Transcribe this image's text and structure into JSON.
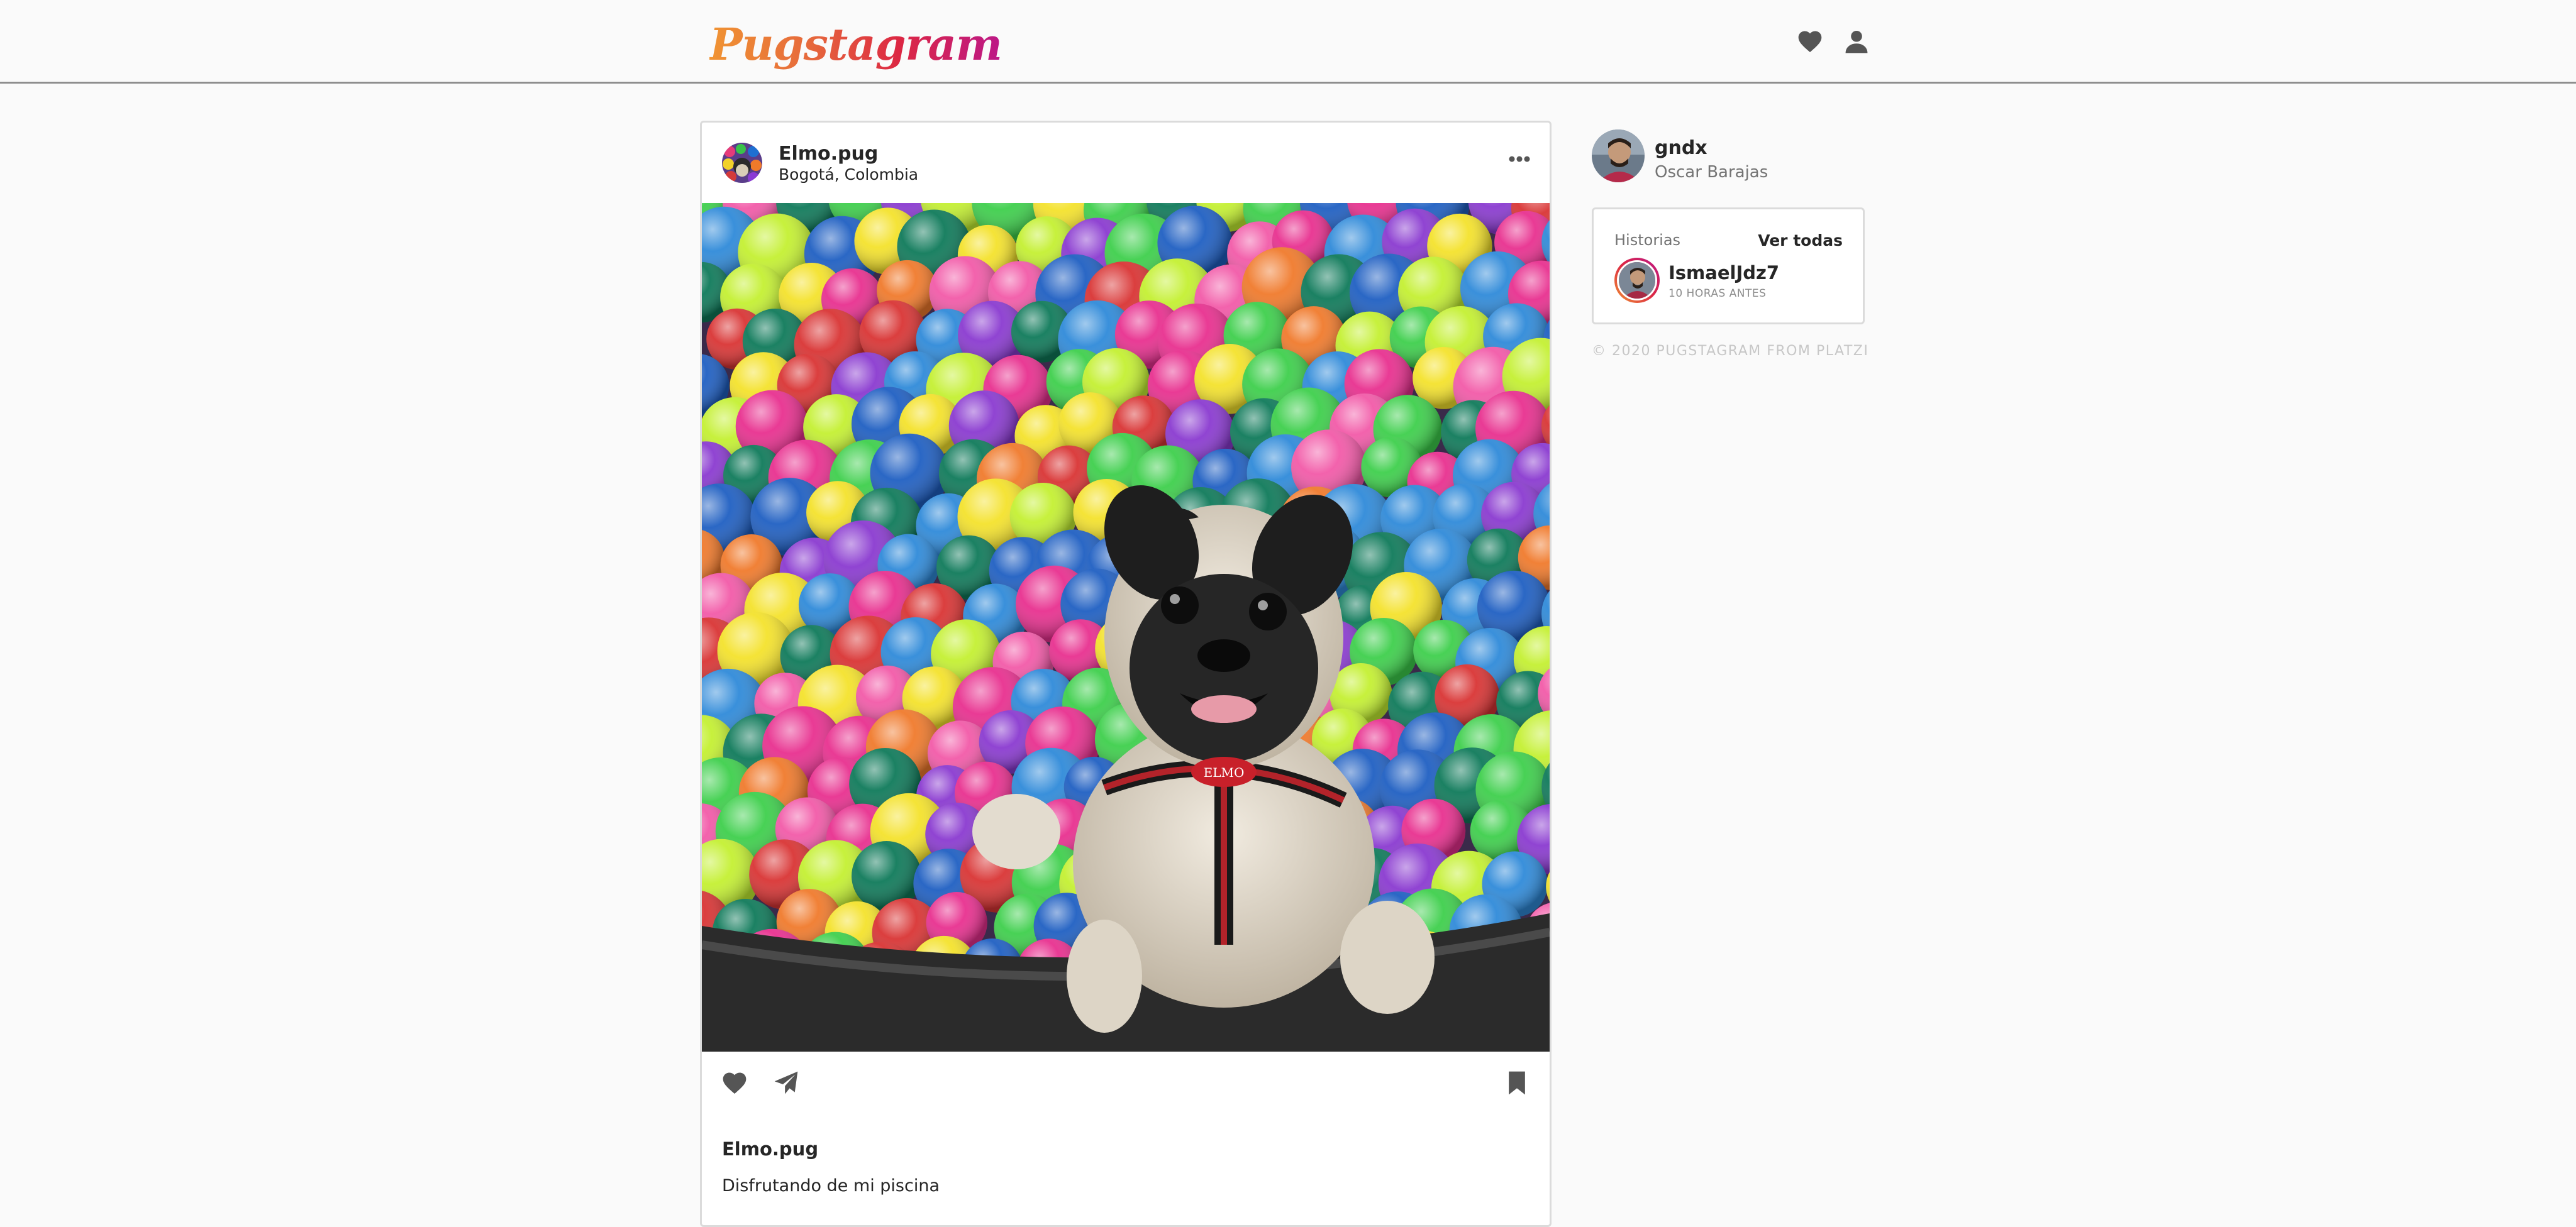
{
  "header": {
    "logo_text": "Pugstagram",
    "icons": [
      "heart-icon",
      "user-icon"
    ]
  },
  "post": {
    "username": "Elmo.pug",
    "location": "Bogotá, Colombia",
    "caption_user": "Elmo.pug",
    "caption_text": "Disfrutando de mi piscina",
    "tag_text": "ELMO",
    "actions": [
      "heart-icon",
      "send-icon",
      "bookmark-icon"
    ]
  },
  "sidebar": {
    "username": "gndx",
    "name": "Oscar Barajas",
    "stories": {
      "title": "Historias",
      "see_all": "Ver todas",
      "items": [
        {
          "username": "IsmaelJdz7",
          "time": "10 HORAS ANTES"
        }
      ]
    },
    "footer": "© 2020 PUGSTAGRAM FROM PLATZI"
  },
  "colors": {
    "background": "#fafafa",
    "card": "#ffffff",
    "border": "#dbdbdb",
    "icon": "#555555",
    "logo_gradient": [
      "#f09433",
      "#e6683c",
      "#dc2743",
      "#bc1888"
    ]
  }
}
